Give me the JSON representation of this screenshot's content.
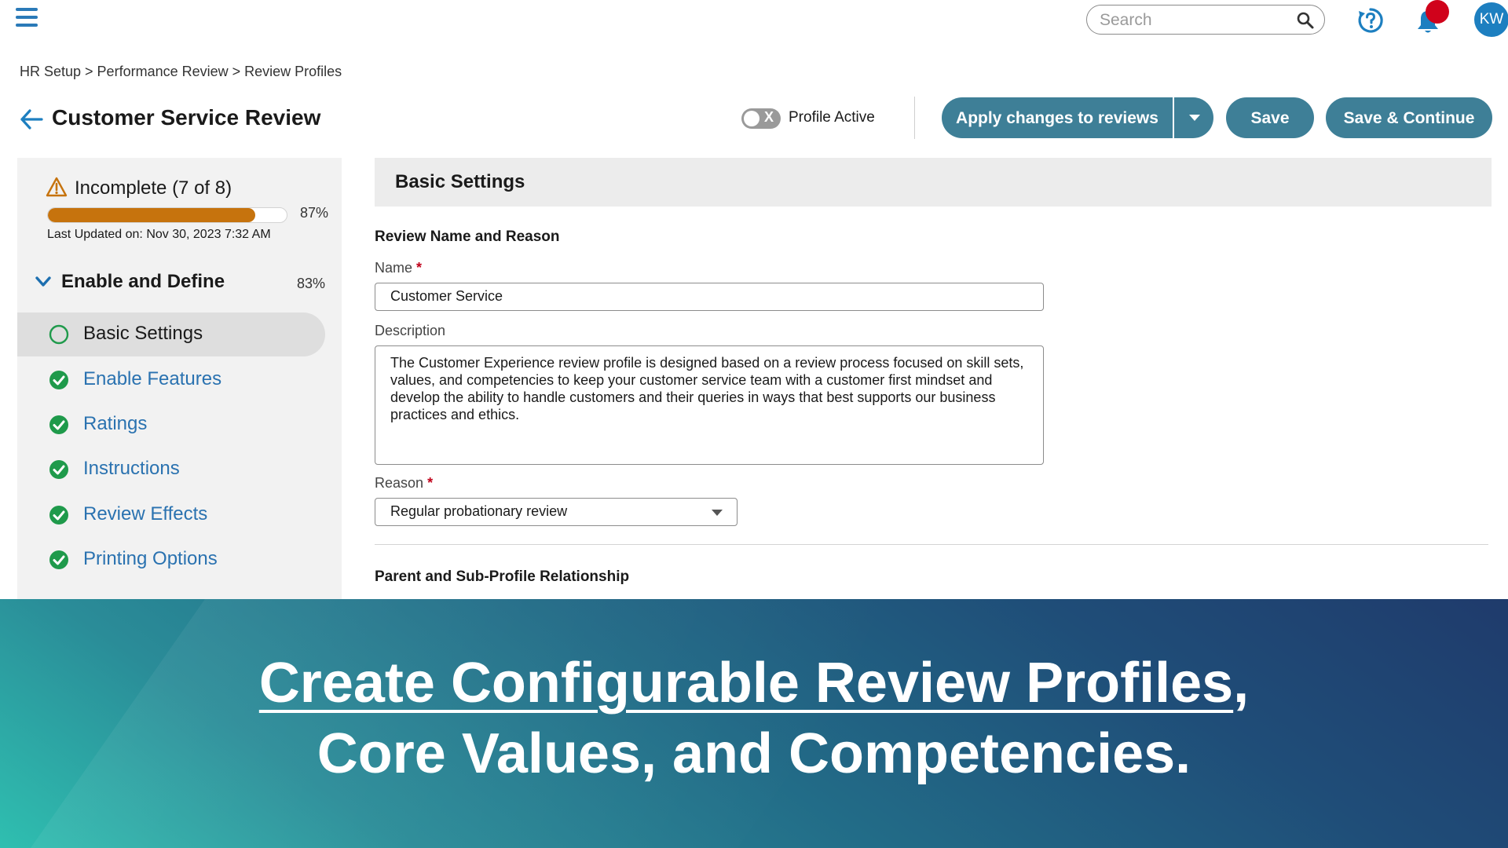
{
  "topbar": {
    "search_placeholder": "Search",
    "avatar_initials": "KW"
  },
  "breadcrumb": "HR Setup > Performance Review > Review Profiles",
  "page_title": "Customer Service Review",
  "profile_toggle": {
    "label": "Profile Active",
    "state_glyph": "X"
  },
  "actions": {
    "apply_label": "Apply changes to reviews",
    "save_label": "Save",
    "save_continue_label": "Save & Continue"
  },
  "sidebar": {
    "status_text": "Incomplete (7 of 8)",
    "progress_fraction": 0.87,
    "progress_pct": "87%",
    "last_updated": "Last Updated on: Nov 30, 2023 7:32 AM",
    "section_title": "Enable and Define",
    "section_pct": "83%",
    "items": [
      {
        "label": "Basic Settings",
        "status": "in-progress"
      },
      {
        "label": "Enable Features",
        "status": "complete"
      },
      {
        "label": "Ratings",
        "status": "complete"
      },
      {
        "label": "Instructions",
        "status": "complete"
      },
      {
        "label": "Review Effects",
        "status": "complete"
      },
      {
        "label": "Printing Options",
        "status": "complete"
      }
    ]
  },
  "form": {
    "section_title": "Basic Settings",
    "group1_title": "Review Name and Reason",
    "name_label": "Name",
    "name_value": "Customer Service",
    "description_label": "Description",
    "description_value": "The Customer Experience review profile is designed based on a review process focused on skill sets, values, and competencies to keep your customer service team with a customer first mindset and develop the ability to handle customers and their queries in ways that best supports our business practices and ethics.",
    "reason_label": "Reason",
    "reason_value": "Regular probationary review",
    "required_marker": "*",
    "group2_title": "Parent and Sub-Profile Relationship"
  },
  "banner": {
    "line1_underlined": "Create Configurable Review Profiles",
    "line1_tail": ",",
    "line2": "Core Values, and Competencies."
  },
  "colors": {
    "accent_button": "#3e7f97",
    "link_blue": "#2a72b0",
    "progress_orange": "#c6730d",
    "check_green": "#1f9a4b",
    "notification_red": "#d0021b"
  }
}
